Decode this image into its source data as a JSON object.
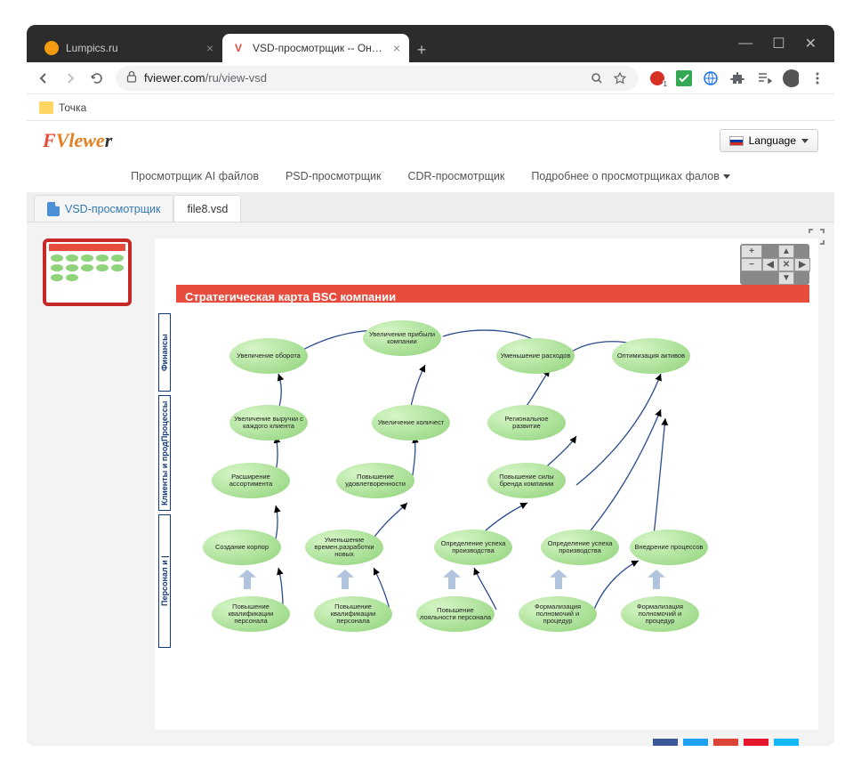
{
  "browser": {
    "tabs": [
      {
        "title": "Lumpics.ru",
        "active": false,
        "favicon": "#f39c12"
      },
      {
        "title": "VSD-просмотрщик -- Онлайн п…",
        "active": true,
        "favicon": "#e74c3c"
      }
    ],
    "url_host": "fviewer.com",
    "url_path": "/ru/view-vsd",
    "bookmark": "Точка"
  },
  "header": {
    "logo_f": "F",
    "logo_v": "Vlewe",
    "logo_r": "r",
    "language_label": "Language"
  },
  "nav": {
    "items": [
      "Просмотрщик AI файлов",
      "PSD-просмотрщик",
      "CDR-просмотрщик",
      "Подробнее о просмотрщиках фалов"
    ]
  },
  "app_tabs": {
    "main_label": "VSD-просмотрщик",
    "file_label": "file8.vsd"
  },
  "diagram": {
    "title": "Стратегическая карта BSC компании",
    "row_labels": [
      "Финансы",
      "Клиенты и продПроцессы",
      "Персонал и |"
    ],
    "bubbles": {
      "r1": [
        "Увеличение оборота",
        "Увеличение прибыли компании",
        "Уменьшение расходов",
        "Оптимизация активов"
      ],
      "r2": [
        "Увеличение выручки с каждого клиента",
        "Увеличение количест",
        "Региональное развитие"
      ],
      "r3": [
        "Расширение ассортимента",
        "Повышение удовлетворенности",
        "Повышение силы бренда компании"
      ],
      "r4": [
        "Создание корпор",
        "Уменьшение времен.разработки новых",
        "Определение успеха производства",
        "Внедрение процессов"
      ],
      "r5": [
        "Повышение квалификации персонала",
        "Повышение лояльности персонала",
        "Формализация полномочий и процедур"
      ]
    }
  }
}
